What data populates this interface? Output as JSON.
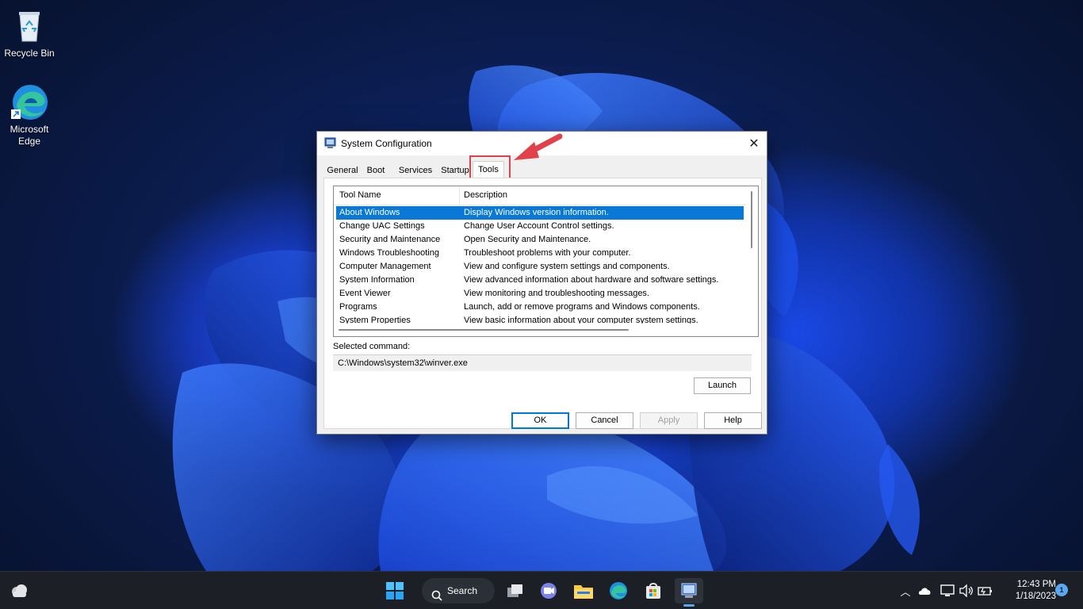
{
  "desktop": {
    "icons": [
      {
        "label": "Recycle Bin",
        "icon": "recycle-bin-icon"
      },
      {
        "label": "Microsoft Edge",
        "icon": "edge-icon"
      }
    ]
  },
  "dialog": {
    "title": "System Configuration",
    "tabs": [
      "General",
      "Boot",
      "Services",
      "Startup",
      "Tools"
    ],
    "active_tab": "Tools",
    "list": {
      "columns": [
        "Tool Name",
        "Description"
      ],
      "rows": [
        {
          "name": "About Windows",
          "desc": "Display Windows version information.",
          "selected": true
        },
        {
          "name": "Change UAC Settings",
          "desc": "Change User Account Control settings."
        },
        {
          "name": "Security and Maintenance",
          "desc": "Open Security and Maintenance."
        },
        {
          "name": "Windows Troubleshooting",
          "desc": "Troubleshoot problems with your computer."
        },
        {
          "name": "Computer Management",
          "desc": "View and configure system settings and components."
        },
        {
          "name": "System Information",
          "desc": "View advanced information about hardware and software settings."
        },
        {
          "name": "Event Viewer",
          "desc": "View monitoring and troubleshooting messages."
        },
        {
          "name": "Programs",
          "desc": "Launch, add or remove programs and Windows components."
        },
        {
          "name": "System Properties",
          "desc": "View basic information about your computer system settings."
        }
      ]
    },
    "selected_command_label": "Selected command:",
    "selected_command_value": "C:\\Windows\\system32\\winver.exe",
    "launch_label": "Launch",
    "buttons": {
      "ok": "OK",
      "cancel": "Cancel",
      "apply": "Apply",
      "help": "Help"
    },
    "highlight_color": "#e0414a"
  },
  "taskbar": {
    "search_label": "Search",
    "clock_time": "12:43 PM",
    "clock_date": "1/18/2023",
    "notification_count": "1",
    "accent": "#5aa9f0"
  }
}
